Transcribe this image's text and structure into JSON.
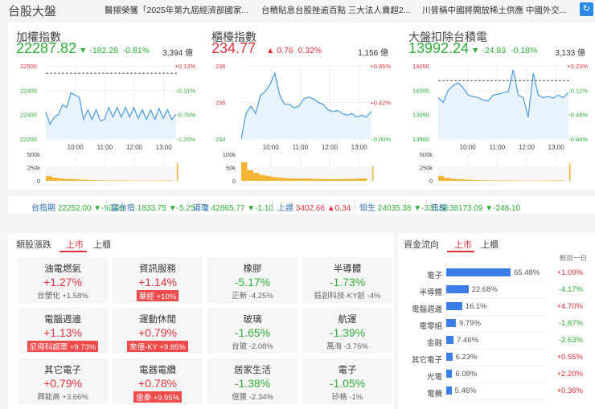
{
  "header": {
    "title": "台股大盤",
    "news": [
      "醫揚榮獲「2025年第九屆經濟部國家...",
      "台積貼息台股挫逾百點 三大法人賣超2...",
      "川普稱中國將開放稀土供應 中國外交..."
    ],
    "refresh_icon": "refresh-icon"
  },
  "indices": [
    {
      "name": "加權指數",
      "value": "22287.82",
      "dir": "down",
      "change": "-182.28",
      "pct": "-0.81%",
      "volume": "3,394 億"
    },
    {
      "name": "櫃檯指數",
      "value": "234.77",
      "dir": "up",
      "change": "0.76",
      "pct": "0.32%",
      "volume": "1,156 億"
    },
    {
      "name": "大盤扣除台積電",
      "value": "13992.24",
      "dir": "down",
      "change": "-24.83",
      "pct": "-0.18%",
      "volume": "3,133 億"
    }
  ],
  "chart_data": [
    {
      "type": "line",
      "ylim": [
        22200,
        22500
      ],
      "yticks": [
        "22500",
        "22400",
        "22300",
        "22200"
      ],
      "pct_ticks": [
        "+0.13%",
        "-0.31%",
        "-0.76%",
        "-1.20%"
      ],
      "tick_dirs": [
        "up",
        "down",
        "down",
        "down"
      ],
      "ref": 22470,
      "xticks": [
        "10:00",
        "11:00",
        "12:00",
        "13:00"
      ],
      "vol_ticks": [
        "500k",
        "250k",
        "0"
      ],
      "vol_max": 500000,
      "prices": [
        22310,
        22260,
        22290,
        22300,
        22340,
        22330,
        22390,
        22380,
        22370,
        22280,
        22320,
        22280,
        22320,
        22275,
        22280,
        22330,
        22290,
        22330,
        22290,
        22330,
        22290,
        22330,
        22285,
        22320,
        22280,
        22320,
        22280,
        22325,
        22285,
        22320,
        22280,
        22300
      ],
      "volumes": [
        90000,
        60000,
        45000,
        35000,
        30000,
        25000,
        20000,
        15000,
        12000,
        10000,
        9000,
        8000,
        8000,
        7000,
        7000,
        6000,
        6000,
        6000,
        7000,
        7000,
        8000,
        330000
      ]
    },
    {
      "type": "line",
      "ylim": [
        234,
        236
      ],
      "yticks": [
        "236",
        "235",
        "234"
      ],
      "pct_ticks": [
        "+0.85%",
        "+0.42%",
        "-0.00%"
      ],
      "tick_dirs": [
        "up",
        "up",
        "down"
      ],
      "ref": null,
      "xticks": [
        "10:00",
        "11:00",
        "12:00",
        "13:00"
      ],
      "vol_ticks": [
        "100k",
        "50k",
        "0"
      ],
      "vol_max": 100000,
      "prices": [
        234,
        234.7,
        234.9,
        234.7,
        235.2,
        235.3,
        235.5,
        235.8,
        235.2,
        234.95,
        234.95,
        234.85,
        234.9,
        235.1,
        235.15,
        235.1,
        235.0,
        234.95,
        234.8,
        234.75,
        234.78,
        234.7,
        234.65,
        234.7,
        234.6,
        234.65,
        234.6,
        234.75
      ],
      "volumes": [
        70000,
        40000,
        30000,
        22000,
        18000,
        14000,
        12000,
        10000,
        9000,
        8000,
        9000,
        8000,
        7000,
        7000,
        6000,
        6000,
        6000,
        7000,
        7000,
        8000,
        9000,
        55000
      ]
    },
    {
      "type": "line",
      "ylim": [
        13900,
        14050
      ],
      "yticks": [
        "14050",
        "14000",
        "13950",
        "13900"
      ],
      "pct_ticks": [
        "+0.23%",
        "-0.12%",
        "-0.48%",
        "-0.84%"
      ],
      "tick_dirs": [
        "up",
        "down",
        "down",
        "down"
      ],
      "ref": 14020,
      "xticks": [
        "10:00",
        "11:00",
        "12:00",
        "13:00"
      ],
      "vol_ticks": [
        "500k",
        "250k",
        "0"
      ],
      "vol_max": 500000,
      "prices": [
        13985,
        13975,
        14000,
        14010,
        14015,
        14005,
        13990,
        13987,
        13985,
        13980,
        13978,
        13990,
        13992,
        13995,
        13997,
        14042,
        13990,
        13985,
        13945,
        14035,
        13990,
        13985,
        13987,
        13984,
        13990,
        13985,
        13995
      ],
      "volumes": [
        90000,
        55000,
        40000,
        30000,
        25000,
        20000,
        15000,
        12000,
        10000,
        9000,
        8000,
        8000,
        7000,
        7000,
        6000,
        6000,
        6000,
        7000,
        7000,
        8000,
        9000,
        330000
      ]
    }
  ],
  "ticker": [
    {
      "name": "台指期",
      "value": "22252.00",
      "change": "▼-92.00",
      "dir": "down"
    },
    {
      "name": "富台指",
      "value": "1833.75",
      "change": "▼-5.25",
      "dir": "down"
    },
    {
      "name": "道瓊",
      "value": "42865.77",
      "change": "▼-1.10",
      "dir": "down"
    },
    {
      "name": "上證",
      "value": "3402.66",
      "change": "▲0.34",
      "dir": "up"
    },
    {
      "name": "恒生",
      "value": "24035.38",
      "change": "▼-331.56",
      "dir": "down"
    },
    {
      "name": "日經",
      "value": "38173.09",
      "change": "▼-248.10",
      "dir": "down"
    }
  ],
  "sectors": {
    "title": "類股漲跌",
    "tabs": [
      "上市",
      "上櫃"
    ],
    "items": [
      {
        "name": "油電燃氣",
        "pct": "+1.27%",
        "dir": "up",
        "stock": "台塑化  +1.58%",
        "hl": false
      },
      {
        "name": "資訊服務",
        "pct": "+1.14%",
        "dir": "up",
        "stock": "華經  +10%",
        "hl": true
      },
      {
        "name": "橡膠",
        "pct": "-5.17%",
        "dir": "down",
        "stock": "正新  -4.25%",
        "hl": false
      },
      {
        "name": "半導體",
        "pct": "-1.73%",
        "dir": "down",
        "stock": "鈺創科技-KY創  -4%",
        "hl": false
      },
      {
        "name": "電腦週邊",
        "pct": "+1.13%",
        "dir": "up",
        "stock": "尼得科超眾  +9.73%",
        "hl": true
      },
      {
        "name": "運動休閒",
        "pct": "+0.79%",
        "dir": "up",
        "stock": "來億-KY  +9.85%",
        "hl": true
      },
      {
        "name": "玻璃",
        "pct": "-1.65%",
        "dir": "down",
        "stock": "台玻  -2.08%",
        "hl": false
      },
      {
        "name": "航運",
        "pct": "-1.39%",
        "dir": "down",
        "stock": "萬海  -3.76%",
        "hl": false
      },
      {
        "name": "其它電子",
        "pct": "+0.79%",
        "dir": "up",
        "stock": "興能高  +3.66%",
        "hl": false
      },
      {
        "name": "電器電纜",
        "pct": "+0.78%",
        "dir": "up",
        "stock": "億泰  +9.95%",
        "hl": true
      },
      {
        "name": "居家生活",
        "pct": "-1.38%",
        "dir": "down",
        "stock": "億豐  -2.34%",
        "hl": false
      },
      {
        "name": "電子",
        "pct": "-1.05%",
        "dir": "down",
        "stock": "矽格  -1%",
        "hl": false
      }
    ]
  },
  "flow": {
    "title": "資金流向",
    "tabs": [
      "上市",
      "上櫃"
    ],
    "col_header": "較前一日",
    "items": [
      {
        "name": "電子",
        "share": 65.48,
        "share_label": "65.48%",
        "change": "+1.09%",
        "dir": "up"
      },
      {
        "name": "半導體",
        "share": 22.68,
        "share_label": "22.68%",
        "change": "-4.17%",
        "dir": "down"
      },
      {
        "name": "電腦週邊",
        "share": 16.1,
        "share_label": "16.1%",
        "change": "+4.70%",
        "dir": "up"
      },
      {
        "name": "電零組",
        "share": 9.79,
        "share_label": "9.79%",
        "change": "-1.87%",
        "dir": "down"
      },
      {
        "name": "金融",
        "share": 7.46,
        "share_label": "7.46%",
        "change": "-2.63%",
        "dir": "down"
      },
      {
        "name": "其它電子",
        "share": 6.23,
        "share_label": "6.23%",
        "change": "+0.55%",
        "dir": "up"
      },
      {
        "name": "光電",
        "share": 6.08,
        "share_label": "6.08%",
        "change": "+2.20%",
        "dir": "up"
      },
      {
        "name": "電機",
        "share": 5.46,
        "share_label": "5.46%",
        "change": "+0.36%",
        "dir": "up"
      }
    ]
  }
}
